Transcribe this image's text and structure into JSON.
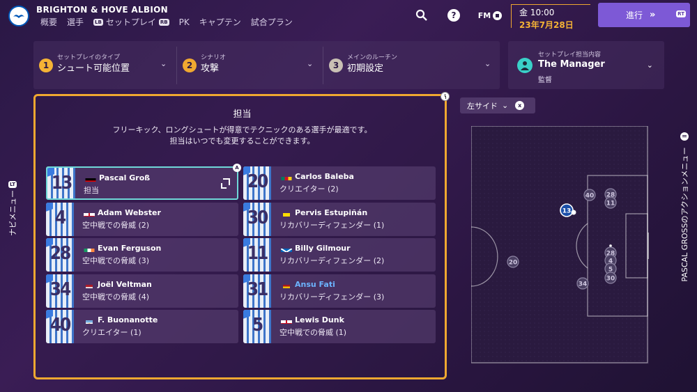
{
  "header": {
    "club_name": "BRIGHTON & HOVE ALBION",
    "nav": [
      "概要",
      "選手",
      "セットプレイ",
      "PK",
      "キャプテン",
      "試合プラン"
    ],
    "nav_pill_left": "LB",
    "nav_pill_right": "RB",
    "fm_label": "FM",
    "help_label": "?",
    "date_time": "金 10:00",
    "date_day": "23年7月28日",
    "advance_label": "進行",
    "advance_pill": "RT"
  },
  "dropdowns": [
    {
      "num": "1",
      "label": "セットプレイのタイプ",
      "value": "シュート可能位置",
      "color": "#f5b335"
    },
    {
      "num": "2",
      "label": "シナリオ",
      "value": "攻撃",
      "color": "#f0a830"
    },
    {
      "num": "3",
      "label": "メインのルーチン",
      "value": "初期設定",
      "color": "#c9c0b4"
    }
  ],
  "coach": {
    "label": "セットプレイ担当内容",
    "name": "The Manager",
    "role": "監督"
  },
  "panel": {
    "title": "担当",
    "desc_line1": "フリーキック、ロングシュートが得意でテクニックのある選手が最適です。",
    "desc_line2": "担当はいつでも変更することができます。",
    "badge": "A"
  },
  "players": [
    {
      "num": "13",
      "name": "Pascal Groß",
      "role": "担当",
      "flag": "de",
      "selected": true
    },
    {
      "num": "20",
      "name": "Carlos Baleba",
      "role": "クリエイター (2)",
      "flag": "cm"
    },
    {
      "num": "4",
      "name": "Adam Webster",
      "role": "空中戦での脅威 (2)",
      "flag": "en"
    },
    {
      "num": "30",
      "name": "Pervis Estupiñán",
      "role": "リカバリーディフェンダー (1)",
      "flag": "ec"
    },
    {
      "num": "28",
      "name": "Evan Ferguson",
      "role": "空中戦での脅威 (3)",
      "flag": "ie"
    },
    {
      "num": "11",
      "name": "Billy Gilmour",
      "role": "リカバリーディフェンダー (2)",
      "flag": "sc"
    },
    {
      "num": "34",
      "name": "Joël Veltman",
      "role": "空中戦での脅威 (4)",
      "flag": "nl"
    },
    {
      "num": "31",
      "name": "Ansu Fati",
      "role": "リカバリーディフェンダー (3)",
      "flag": "es",
      "highlight": true
    },
    {
      "num": "40",
      "name": "F. Buonanotte",
      "role": "クリエイター (1)",
      "flag": "ar"
    },
    {
      "num": "5",
      "name": "Lewis Dunk",
      "role": "空中戦での脅威 (1)",
      "flag": "en"
    }
  ],
  "pitch": {
    "side_label": "左サイド",
    "side_close": "x",
    "markers": [
      "40",
      "28",
      "11",
      "13",
      "28",
      "4",
      "5",
      "30",
      "20",
      "34"
    ]
  },
  "side_menus": {
    "left": "ナビメニュー",
    "left_pill": "LT",
    "right": "PASCAL GROSSのアクションメニュー"
  }
}
